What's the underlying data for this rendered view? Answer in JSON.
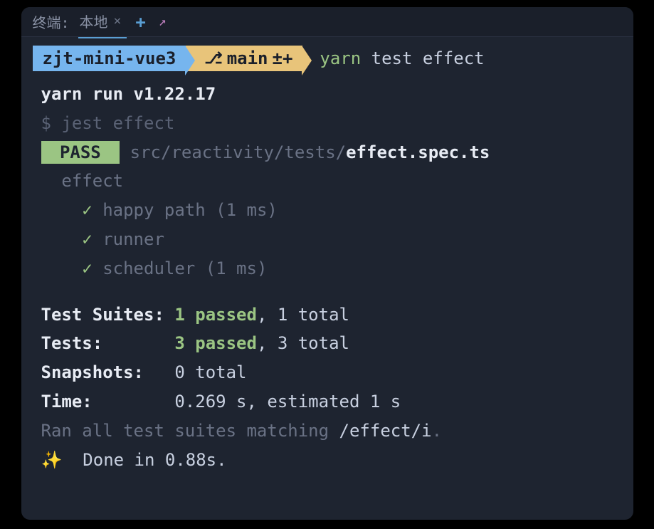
{
  "tabBar": {
    "label": "终端:",
    "tabName": "本地",
    "closeIcon": "×",
    "addIcon": "+",
    "expandIcon": "↗"
  },
  "prompt": {
    "seg1": "zjt-mini-vue3",
    "branch_icon": "⎇",
    "branch": "main",
    "gitStatus": "±+",
    "cmd_part1": "yarn",
    "cmd_part2": " test effect"
  },
  "output": {
    "runLine": "yarn run v1.22.17",
    "dollarPrefix": "$",
    "jestCmd": " jest effect",
    "passBadge": " PASS ",
    "pathDim": "src/reactivity/tests/",
    "fileName": "effect.spec.ts",
    "suiteName": "  effect",
    "tests": [
      {
        "check": "✓",
        "name": " happy path (1 ms)"
      },
      {
        "check": "✓",
        "name": " runner"
      },
      {
        "check": "✓",
        "name": " scheduler (1 ms)"
      }
    ],
    "summary": {
      "suitesLabel": "Test Suites: ",
      "suitesPass": "1 passed",
      "suitesRest": ", 1 total",
      "testsLabel": "Tests:       ",
      "testsPass": "3 passed",
      "testsRest": ", 3 total",
      "snapshotsLabel": "Snapshots:   ",
      "snapshotsVal": "0 total",
      "timeLabel": "Time:        ",
      "timeVal": "0.269 s, estimated 1 s"
    },
    "ranLine_p1": "Ran all test suites matching ",
    "ranLine_p2": "/effect/i",
    "ranLine_p3": ".",
    "sparkle": "✨",
    "doneLine": "  Done in 0.88s."
  }
}
